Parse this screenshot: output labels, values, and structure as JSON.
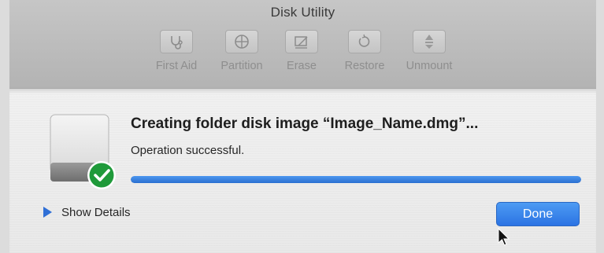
{
  "window": {
    "title": "Disk Utility"
  },
  "toolbar": {
    "items": [
      {
        "label": "First Aid",
        "icon": "stethoscope-icon"
      },
      {
        "label": "Partition",
        "icon": "pie-partition-icon"
      },
      {
        "label": "Erase",
        "icon": "erase-icon"
      },
      {
        "label": "Restore",
        "icon": "restore-icon"
      },
      {
        "label": "Unmount",
        "icon": "eject-icon"
      }
    ],
    "state": "disabled"
  },
  "sheet": {
    "heading": "Creating folder disk image “Image_Name.dmg”...",
    "status": "Operation successful.",
    "progress": 1.0,
    "icon": "hard-disk-with-checkmark-icon",
    "details_label": "Show Details",
    "done_label": "Done"
  },
  "colors": {
    "accent": "#2f7be8",
    "progress_fill": "#3a85e6",
    "checkmark_green": "#1f9a3a",
    "toolbar_bg": "#b9b9b9"
  }
}
